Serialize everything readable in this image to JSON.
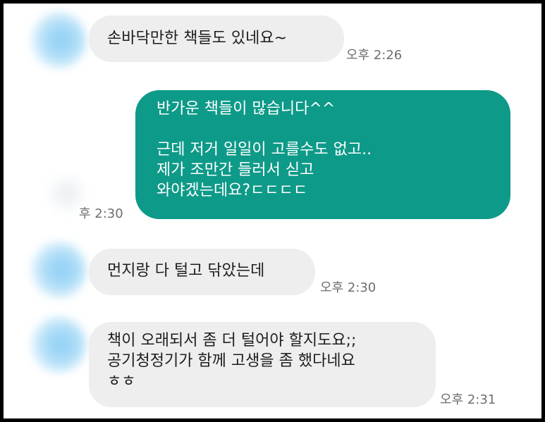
{
  "messages": [
    {
      "sender": "other",
      "text": "손바닥만한 책들도 있네요~",
      "time": "오후 2:26"
    },
    {
      "sender": "me",
      "text": "반가운 책들이 많습니다^^\n\n근데 저거 일일이 고를수도 없고..\n제가 조만간 들러서 싣고\n와야겠는데요?ㄷㄷㄷㄷ",
      "time": "후 2:30"
    },
    {
      "sender": "other",
      "text": "먼지랑 다 털고 닦았는데",
      "time": "오후 2:30"
    },
    {
      "sender": "other",
      "text": "책이 오래되서 좀 더 털어야 할지도요;;\n공기청정기가 함께 고생을 좀 했다네요\nㅎㅎ",
      "time": "오후 2:31"
    }
  ],
  "colors": {
    "incoming_bubble": "#eeeeee",
    "outgoing_bubble": "#0e9a88",
    "timestamp": "#6e6e6e"
  },
  "icons": {
    "avatar": "blurred-profile-avatar"
  }
}
